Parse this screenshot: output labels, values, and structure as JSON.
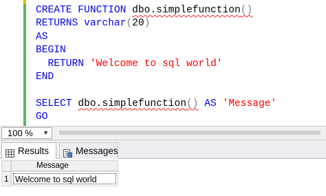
{
  "editor": {
    "lines": [
      [
        {
          "t": "CREATE FUNCTION ",
          "c": "kw"
        },
        {
          "t": "dbo.simplefunction",
          "c": "sq"
        },
        {
          "t": "()",
          "c": "op sq"
        }
      ],
      [
        {
          "t": "RETURNS ",
          "c": "kw"
        },
        {
          "t": "varchar",
          "c": "kw"
        },
        {
          "t": "(",
          "c": "op"
        },
        {
          "t": "20",
          "c": ""
        },
        {
          "t": ")",
          "c": "op"
        }
      ],
      [
        {
          "t": "AS",
          "c": "kw"
        }
      ],
      [
        {
          "t": "BEGIN",
          "c": "kw"
        }
      ],
      [
        {
          "t": "  RETURN ",
          "c": "kw"
        },
        {
          "t": "'Welcome to sql world'",
          "c": "str"
        }
      ],
      [
        {
          "t": "END",
          "c": "kw"
        }
      ],
      [
        {
          "t": "",
          "c": ""
        }
      ],
      [
        {
          "t": "SELECT ",
          "c": "kw"
        },
        {
          "t": "dbo.simplefunction",
          "c": "sq"
        },
        {
          "t": "()",
          "c": "op sq"
        },
        {
          "t": " AS ",
          "c": "kw"
        },
        {
          "t": "'Message'",
          "c": "str"
        }
      ],
      [
        {
          "t": "GO",
          "c": "kw"
        }
      ]
    ]
  },
  "zoom": {
    "value": "100 %"
  },
  "tabs": {
    "results_label": "Results",
    "messages_label": "Messages"
  },
  "grid": {
    "columns": [
      "Message"
    ],
    "rows": [
      {
        "num": "1",
        "values": [
          "Welcome to sql world"
        ]
      }
    ]
  },
  "colors": {
    "keyword": "#0000ff",
    "string": "#ff0000",
    "operator": "#808080",
    "change_bar": "#5fb35f"
  }
}
